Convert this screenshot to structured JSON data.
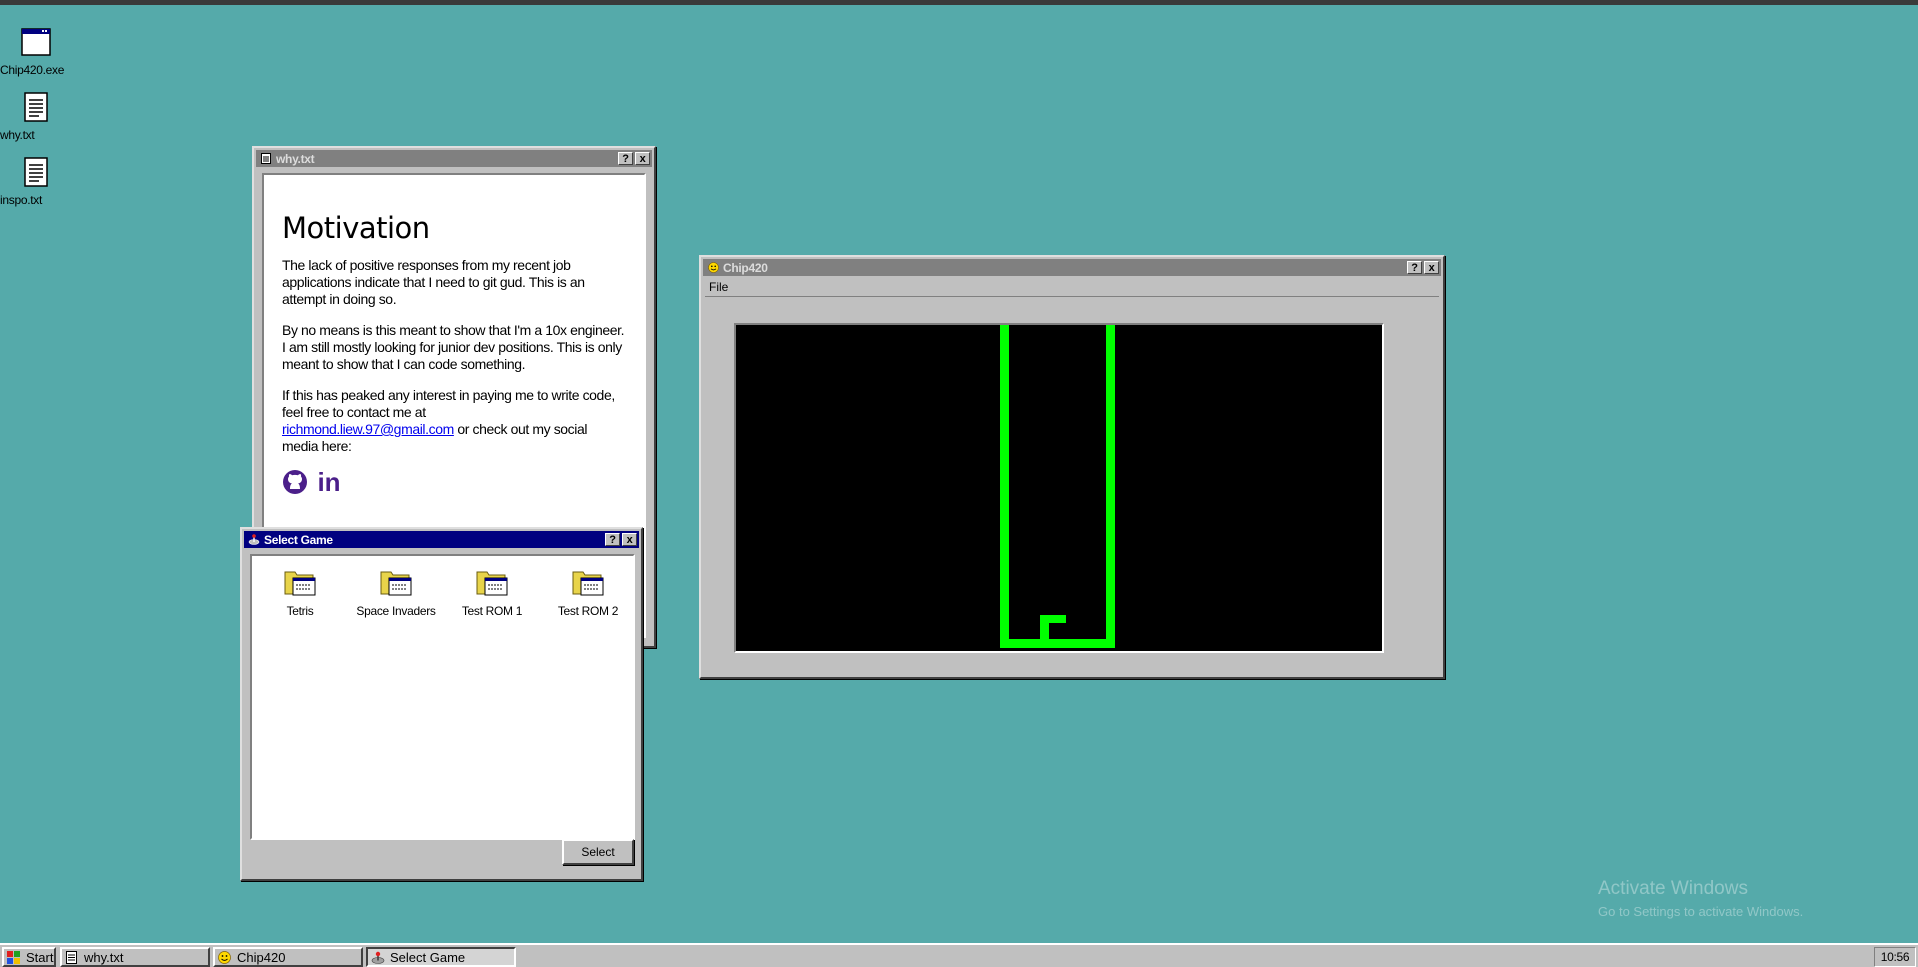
{
  "desktop": {
    "icons": [
      {
        "label": "Chip420.exe",
        "icon": "window-app-icon"
      },
      {
        "label": "why.txt",
        "icon": "text-file-icon"
      },
      {
        "label": "inspo.txt",
        "icon": "text-file-icon"
      }
    ],
    "background_color": "#55aaaa"
  },
  "why_window": {
    "title": "why.txt",
    "help_btn": "?",
    "close_btn": "x",
    "heading": "Motivation",
    "para1": "The lack of positive responses from my recent job applications indicate that I need to git gud. This is an attempt in doing so.",
    "para2": "By no means is this meant to show that I'm a 10x engineer. I am still mostly looking for junior dev positions. This is only meant to show that I can code something.",
    "para3_before": "If this has peaked any interest in paying me to write code, feel free to contact me at",
    "email": "richmond.liew.97@gmail.com",
    "para3_after": "or check out my social media here:",
    "social": [
      "github-icon",
      "linkedin-icon"
    ],
    "linkedin_text": "in"
  },
  "chip_window": {
    "title": "Chip420",
    "help_btn": "?",
    "close_btn": "x",
    "menu": [
      "File"
    ],
    "pixel_color": "#00ff00"
  },
  "select_window": {
    "title": "Select Game",
    "help_btn": "?",
    "close_btn": "x",
    "games": [
      "Tetris",
      "Space Invaders",
      "Test ROM 1",
      "Test ROM 2"
    ],
    "select_label": "Select"
  },
  "watermark": {
    "line1": "Activate Windows",
    "line2": "Go to Settings to activate Windows."
  },
  "taskbar": {
    "start_label": "Start",
    "tasks": [
      "why.txt",
      "Chip420",
      "Select Game"
    ],
    "clock": "10:56"
  }
}
